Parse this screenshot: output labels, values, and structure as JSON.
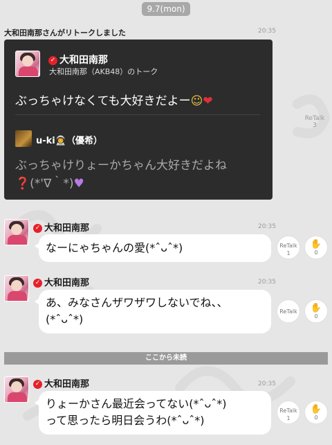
{
  "date_pill": "9.7(mon)",
  "retalk_notice": "大和田南那さんがリトークしました",
  "card": {
    "time": "20:35",
    "name": "大和田南那",
    "subtitle": "大和田南那（AKB48）のトーク",
    "message": "ぶっちゃけなくても大好きだよー",
    "reply_name": "u-ki",
    "reply_name_suffix": "（優希）",
    "reply_text_1": "ぶっちゃけりょーかちゃん大好きだよね",
    "reply_text_2": "(*'∇｀*)",
    "retalk_label": "ReTalk",
    "retalk_count": "3"
  },
  "messages": [
    {
      "sender": "大和田南那",
      "time": "20:35",
      "text_lines": [
        "なーにゃちゃんの愛(*ˆᴗˆ*)"
      ],
      "retalk_label": "ReTalk",
      "retalk_count": "1",
      "clap_count": "0"
    },
    {
      "sender": "大和田南那",
      "time": "20:35",
      "text_lines": [
        "あ、みなさんザワザワしないでね、、",
        "(*ˆᴗˆ*)"
      ],
      "retalk_label": "ReTalk",
      "retalk_count": "0",
      "clap_count": "0"
    },
    {
      "sender": "大和田南那",
      "time": "20:35",
      "text_lines": [
        "りょーかさん最近会ってない(*ˆᴗˆ*)",
        "って思ったら明日会うわ(*ˆᴗˆ*)"
      ],
      "retalk_label": "ReTalk",
      "retalk_count": "1",
      "clap_count": "0"
    }
  ],
  "unread_divider": "ここから未読",
  "colors": {
    "verified": "#e4212b",
    "card_bg": "#2c2c2c",
    "bubble_bg": "#ffffff",
    "page_bg": "#e6e6e6"
  },
  "icons": [
    "verified-check-icon",
    "clap-icon",
    "heart-emoji",
    "smile-emoji",
    "purple-heart-emoji",
    "question-emoji"
  ]
}
